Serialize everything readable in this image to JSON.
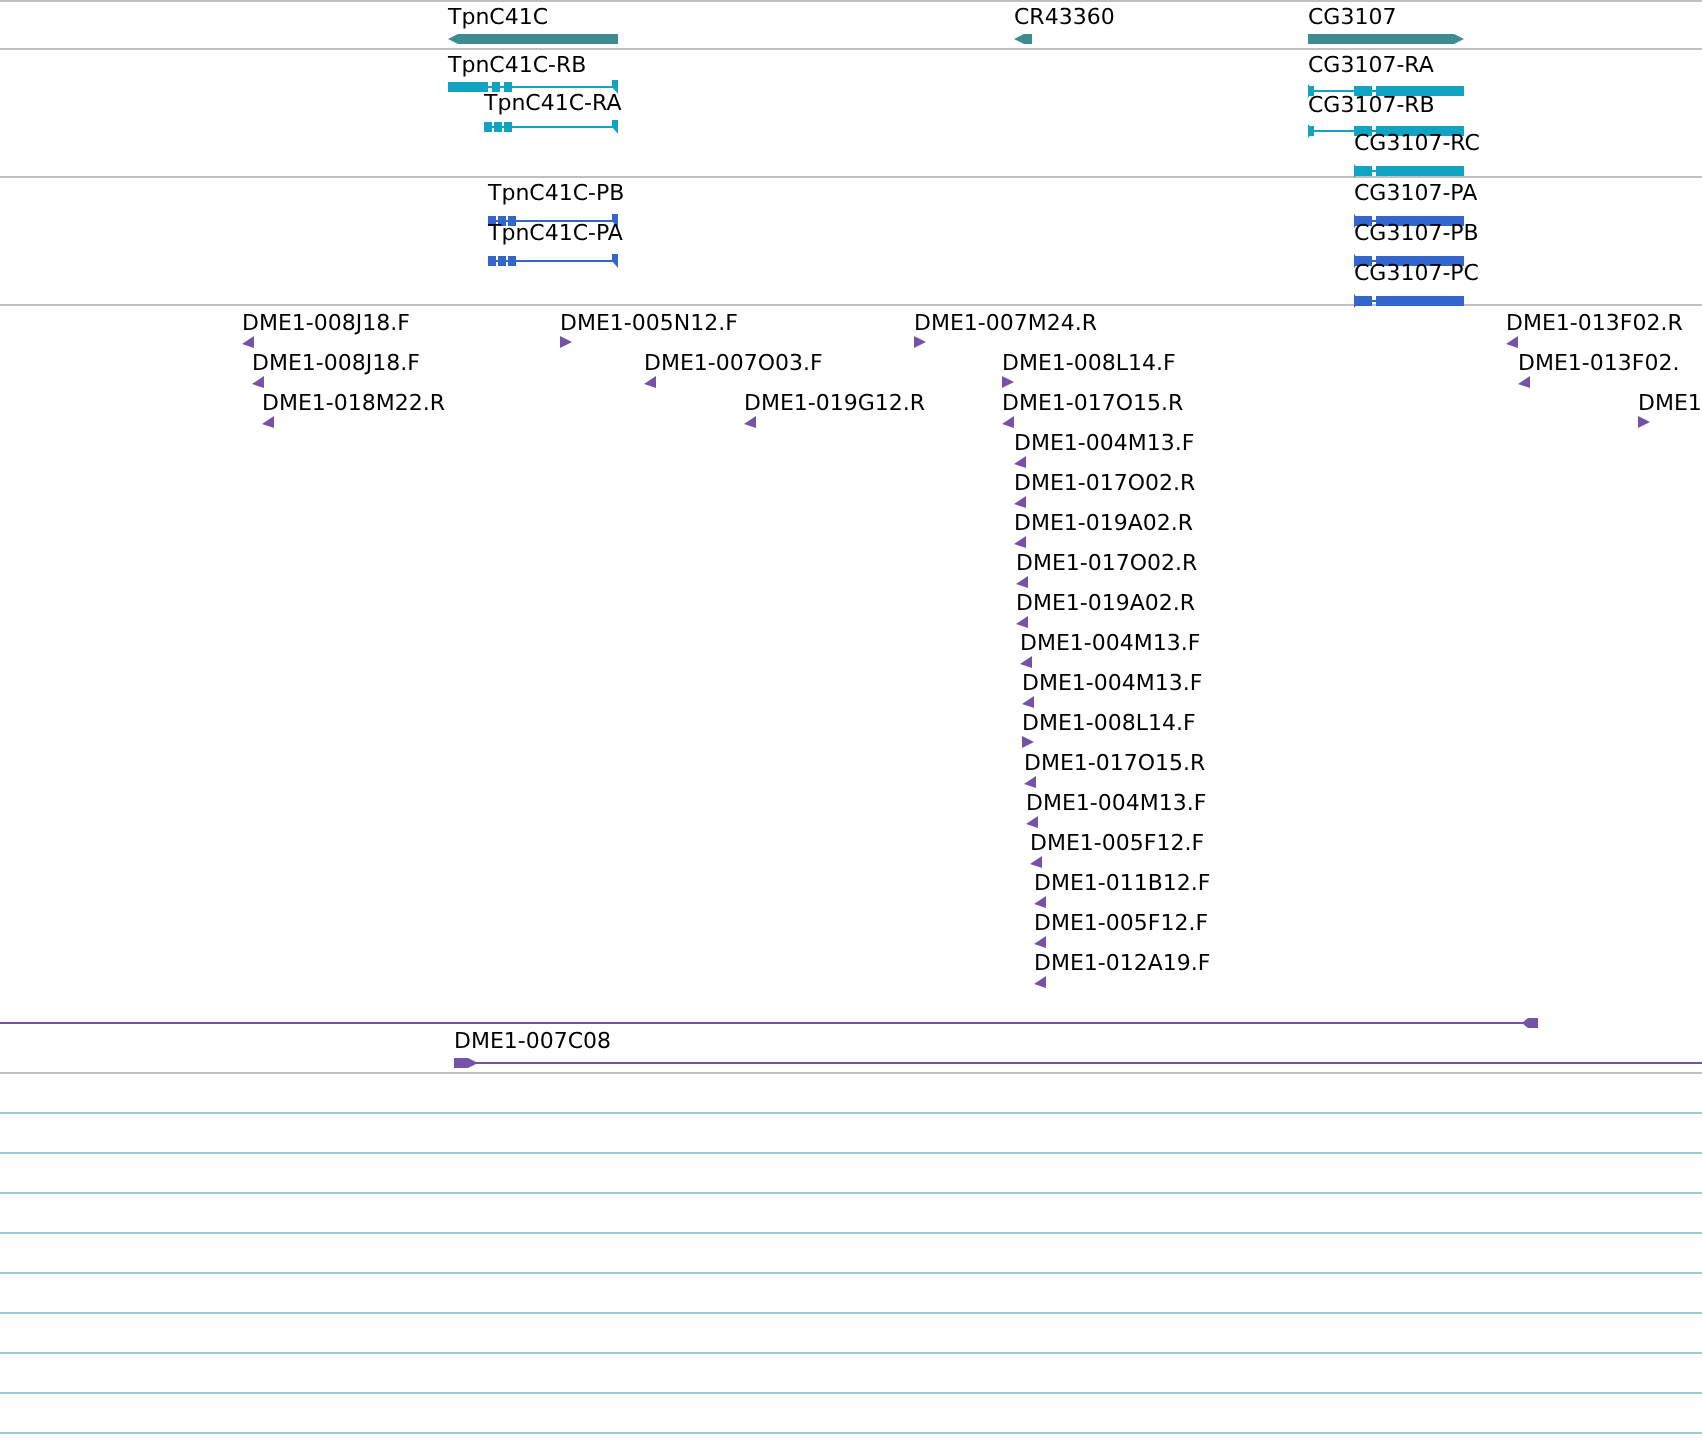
{
  "tracks": [
    {
      "kind": "gene",
      "features": [
        {
          "label": "TpnC41C",
          "reverse": true
        },
        {
          "label": "CR43360",
          "reverse": true
        },
        {
          "label": "CG3107",
          "reverse": false
        }
      ]
    },
    {
      "kind": "transcript",
      "features": [
        {
          "label": "TpnC41C-RB",
          "reverse": true
        },
        {
          "label": "TpnC41C-RA",
          "reverse": true
        },
        {
          "label": "CG3107-RA",
          "reverse": false
        },
        {
          "label": "CG3107-RB",
          "reverse": false
        },
        {
          "label": "CG3107-RC",
          "reverse": false
        }
      ]
    },
    {
      "kind": "protein",
      "features": [
        {
          "label": "TpnC41C-PB",
          "reverse": true
        },
        {
          "label": "TpnC41C-PA",
          "reverse": true
        },
        {
          "label": "CG3107-PA",
          "reverse": false
        },
        {
          "label": "CG3107-PB",
          "reverse": false
        },
        {
          "label": "CG3107-PC",
          "reverse": false
        }
      ]
    },
    {
      "kind": "est",
      "features": [
        {
          "label": "DME1-008J18.F",
          "reverse": true
        },
        {
          "label": "DME1-005N12.F",
          "reverse": false
        },
        {
          "label": "DME1-007M24.R",
          "reverse": false
        },
        {
          "label": "DME1-013F02.R",
          "reverse": true
        },
        {
          "label": "DME1-008J18.F",
          "reverse": true
        },
        {
          "label": "DME1-007O03.F",
          "reverse": true
        },
        {
          "label": "DME1-008L14.F",
          "reverse": false
        },
        {
          "label": "DME1-013F02.",
          "reverse": true
        },
        {
          "label": "DME1-018M22.R",
          "reverse": true
        },
        {
          "label": "DME1-019G12.R",
          "reverse": true
        },
        {
          "label": "DME1-017O15.R",
          "reverse": true
        },
        {
          "label": "DME1",
          "reverse": false
        },
        {
          "label": "DME1-004M13.F",
          "reverse": true
        },
        {
          "label": "DME1-017O02.R",
          "reverse": true
        },
        {
          "label": "DME1-019A02.R",
          "reverse": true
        },
        {
          "label": "DME1-017O02.R",
          "reverse": true
        },
        {
          "label": "DME1-019A02.R",
          "reverse": true
        },
        {
          "label": "DME1-004M13.F",
          "reverse": true
        },
        {
          "label": "DME1-004M13.F",
          "reverse": true
        },
        {
          "label": "DME1-008L14.F",
          "reverse": false
        },
        {
          "label": "DME1-017O15.R",
          "reverse": true
        },
        {
          "label": "DME1-004M13.F",
          "reverse": true
        },
        {
          "label": "DME1-005F12.F",
          "reverse": true
        },
        {
          "label": "DME1-011B12.F",
          "reverse": true
        },
        {
          "label": "DME1-005F12.F",
          "reverse": true
        },
        {
          "label": "DME1-012A19.F",
          "reverse": true
        },
        {
          "reverse": true
        },
        {
          "label": "DME1-007C08",
          "reverse": false
        }
      ]
    }
  ]
}
